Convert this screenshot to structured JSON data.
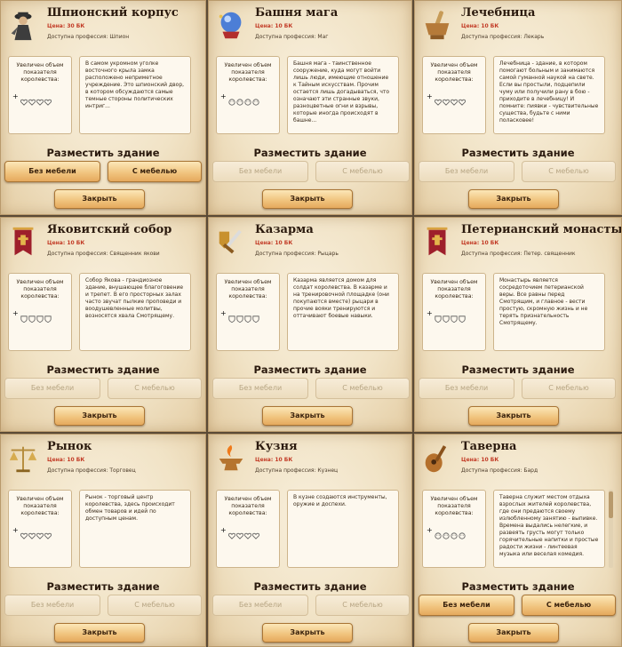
{
  "place_label": "Разместить здание",
  "btn_no_furniture": "Без мебели",
  "btn_with_furniture": "С мебелью",
  "close_label": "Закрыть",
  "stat_label": "Увеличен объем показателя королевства:",
  "stat_plus": "+",
  "cards": [
    {
      "title": "Шпионский корпус",
      "price": "Цена: 30 БК",
      "prof": "Доступна профессия: Шпион",
      "icon": "spy-icon",
      "stat_icon": "heart-icon",
      "buttons_active": true,
      "desc": "В самом укромном уголке восточного крыла замка расположено неприметное учреждение. Это шпионский двор, в котором обсуждаются самые темные стороны политических интриг..."
    },
    {
      "title": "Башня мага",
      "price": "Цена: 10 БК",
      "prof": "Доступна профессия: Маг",
      "icon": "crystal-ball-icon",
      "stat_icon": "mask-icon",
      "buttons_active": false,
      "desc": "Башня мага - таинственное сооружение, куда могут войти лишь люди, имеющие отношение к Тайным искусствам. Прочим остается лишь догадываться, что означают эти странные звуки, разноцветные огни и взрывы, которые иногда происходят в башне..."
    },
    {
      "title": "Лечебница",
      "price": "Цена: 10 БК",
      "prof": "Доступна профессия: Лекарь",
      "icon": "mortar-pestle-icon",
      "stat_icon": "heart-icon",
      "buttons_active": false,
      "desc": "Лечебница - здание, в котором помогают больным и занимаются самой гуманной наукой на свете. Если вы простыли, подцепили чуму или получили рану в бою - приходите в лечебницу! И помните: пиявки - чувствительные существа, будьте с ними поласковее!"
    },
    {
      "title": "Яковитский собор",
      "price": "Цена: 10 БК",
      "prof": "Доступна профессия: Священник якови",
      "icon": "banner-icon",
      "stat_icon": "shield-icon",
      "buttons_active": false,
      "desc": "Собор Якова - грандиозное здание, внушающее благоговение и трепет. В его просторных залах часто звучат пылкие проповеди и воодушевленные молитвы, возносятся хвала Смотрящему."
    },
    {
      "title": "Казарма",
      "price": "Цена: 10 БК",
      "prof": "Доступна профессия: Рыцарь",
      "icon": "sword-shield-icon",
      "stat_icon": "shield-icon",
      "buttons_active": false,
      "desc": "Казарма является домом для солдат королевства. В казарме и на тренировочной площадке (они покупаются вместе) рыцари в прочие вояки тренируются и оттачивают боевые навыки."
    },
    {
      "title": "Петерианский монастырь",
      "price": "Цена: 10 БК",
      "prof": "Доступна профессия: Петер. священник",
      "icon": "banner-icon",
      "stat_icon": "shield-icon",
      "buttons_active": false,
      "desc": "Монастырь является сосредоточием петерианской веры. Все равны перед Смотрящим, и главное - вести простую, скромную жизнь и не терять признательность Смотрящему."
    },
    {
      "title": "Рынок",
      "price": "Цена: 10 БК",
      "prof": "Доступна профессия: Торговец",
      "icon": "scales-icon",
      "stat_icon": "heart-icon",
      "buttons_active": false,
      "desc": "Рынок - торговый центр королевства, здесь происходит обмен товаров и идей по доступным ценам."
    },
    {
      "title": "Кузня",
      "price": "Цена: 10 БК",
      "prof": "Доступна профессия: Кузнец",
      "icon": "anvil-icon",
      "stat_icon": "heart-icon",
      "buttons_active": false,
      "desc": "В кузне создаются инструменты, оружие и доспехи."
    },
    {
      "title": "Таверна",
      "price": "Цена: 10 БК",
      "prof": "Доступна профессия: Бард",
      "icon": "lute-icon",
      "stat_icon": "mask-icon",
      "buttons_active": true,
      "desc": "Таверна служит местом отдыха взрослых жителей королевства, где они предаются своему излюбленному занятию - выпивке. Времена выдались нелегкие, и развеять грусть могут только горячительные напитки и простые радости жизни - линтеевая музыка или веселая комедия."
    }
  ]
}
